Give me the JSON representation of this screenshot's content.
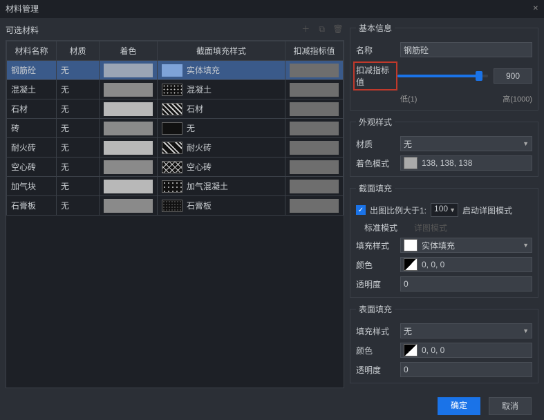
{
  "title": "材料管理",
  "left": {
    "label": "可选材料",
    "columns": [
      "材料名称",
      "材质",
      "着色",
      "截面填充样式",
      "扣减指标值"
    ],
    "rows": [
      {
        "name": "钢筋砼",
        "mat": "无",
        "fill": "实体填充",
        "selected": true
      },
      {
        "name": "混凝土",
        "mat": "无",
        "fill": "混凝土"
      },
      {
        "name": "石材",
        "mat": "无",
        "fill": "石材"
      },
      {
        "name": "砖",
        "mat": "无",
        "fill": "无"
      },
      {
        "name": "耐火砖",
        "mat": "无",
        "fill": "耐火砖"
      },
      {
        "name": "空心砖",
        "mat": "无",
        "fill": "空心砖"
      },
      {
        "name": "加气块",
        "mat": "无",
        "fill": "加气混凝土"
      },
      {
        "name": "石膏板",
        "mat": "无",
        "fill": "石膏板"
      }
    ]
  },
  "basic": {
    "legend": "基本信息",
    "name_lbl": "名称",
    "name_val": "钢筋砼",
    "reduce_lbl": "扣减指标值",
    "reduce_val": "900",
    "low": "低(1)",
    "high": "高(1000)"
  },
  "appearance": {
    "legend": "外观样式",
    "mat_lbl": "材质",
    "mat_val": "无",
    "color_lbl": "着色模式",
    "color_val": "138, 138, 138"
  },
  "section": {
    "legend": "截面填充",
    "ratio_prefix": "出图比例大于1:",
    "ratio_val": "100",
    "ratio_suffix": "启动详图模式",
    "tab_std": "标准模式",
    "tab_detail": "详图模式",
    "fill_lbl": "填充样式",
    "fill_val": "实体填充",
    "color_lbl": "颜色",
    "color_val": "0, 0, 0",
    "opacity_lbl": "透明度",
    "opacity_val": "0"
  },
  "surface": {
    "legend": "表面填充",
    "fill_lbl": "填充样式",
    "fill_val": "无",
    "color_lbl": "颜色",
    "color_val": "0, 0, 0",
    "opacity_lbl": "透明度",
    "opacity_val": "0"
  },
  "footer": {
    "ok": "确定",
    "cancel": "取消"
  }
}
